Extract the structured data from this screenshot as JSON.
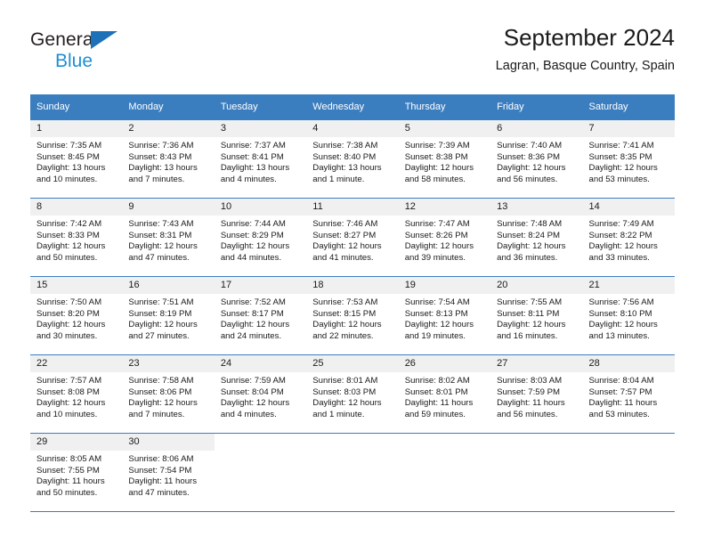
{
  "brand": {
    "name_top": "General",
    "name_bottom": "Blue",
    "accent_color": "#1d8fd4",
    "triangle_color": "#1d71b8"
  },
  "header": {
    "title": "September 2024",
    "location": "Lagran, Basque Country, Spain"
  },
  "theme": {
    "header_bg": "#3b7ec0",
    "daynum_bg": "#f0f0f0",
    "text_color": "#1a1a1a",
    "grid_line": "#3b7ec0"
  },
  "weekdays": [
    "Sunday",
    "Monday",
    "Tuesday",
    "Wednesday",
    "Thursday",
    "Friday",
    "Saturday"
  ],
  "labels": {
    "sunrise_prefix": "Sunrise:",
    "sunset_prefix": "Sunset:",
    "daylight_prefix": "Daylight:"
  },
  "weeks": [
    [
      {
        "day": "1",
        "sunrise": "Sunrise: 7:35 AM",
        "sunset": "Sunset: 8:45 PM",
        "daylight": "Daylight: 13 hours and 10 minutes."
      },
      {
        "day": "2",
        "sunrise": "Sunrise: 7:36 AM",
        "sunset": "Sunset: 8:43 PM",
        "daylight": "Daylight: 13 hours and 7 minutes."
      },
      {
        "day": "3",
        "sunrise": "Sunrise: 7:37 AM",
        "sunset": "Sunset: 8:41 PM",
        "daylight": "Daylight: 13 hours and 4 minutes."
      },
      {
        "day": "4",
        "sunrise": "Sunrise: 7:38 AM",
        "sunset": "Sunset: 8:40 PM",
        "daylight": "Daylight: 13 hours and 1 minute."
      },
      {
        "day": "5",
        "sunrise": "Sunrise: 7:39 AM",
        "sunset": "Sunset: 8:38 PM",
        "daylight": "Daylight: 12 hours and 58 minutes."
      },
      {
        "day": "6",
        "sunrise": "Sunrise: 7:40 AM",
        "sunset": "Sunset: 8:36 PM",
        "daylight": "Daylight: 12 hours and 56 minutes."
      },
      {
        "day": "7",
        "sunrise": "Sunrise: 7:41 AM",
        "sunset": "Sunset: 8:35 PM",
        "daylight": "Daylight: 12 hours and 53 minutes."
      }
    ],
    [
      {
        "day": "8",
        "sunrise": "Sunrise: 7:42 AM",
        "sunset": "Sunset: 8:33 PM",
        "daylight": "Daylight: 12 hours and 50 minutes."
      },
      {
        "day": "9",
        "sunrise": "Sunrise: 7:43 AM",
        "sunset": "Sunset: 8:31 PM",
        "daylight": "Daylight: 12 hours and 47 minutes."
      },
      {
        "day": "10",
        "sunrise": "Sunrise: 7:44 AM",
        "sunset": "Sunset: 8:29 PM",
        "daylight": "Daylight: 12 hours and 44 minutes."
      },
      {
        "day": "11",
        "sunrise": "Sunrise: 7:46 AM",
        "sunset": "Sunset: 8:27 PM",
        "daylight": "Daylight: 12 hours and 41 minutes."
      },
      {
        "day": "12",
        "sunrise": "Sunrise: 7:47 AM",
        "sunset": "Sunset: 8:26 PM",
        "daylight": "Daylight: 12 hours and 39 minutes."
      },
      {
        "day": "13",
        "sunrise": "Sunrise: 7:48 AM",
        "sunset": "Sunset: 8:24 PM",
        "daylight": "Daylight: 12 hours and 36 minutes."
      },
      {
        "day": "14",
        "sunrise": "Sunrise: 7:49 AM",
        "sunset": "Sunset: 8:22 PM",
        "daylight": "Daylight: 12 hours and 33 minutes."
      }
    ],
    [
      {
        "day": "15",
        "sunrise": "Sunrise: 7:50 AM",
        "sunset": "Sunset: 8:20 PM",
        "daylight": "Daylight: 12 hours and 30 minutes."
      },
      {
        "day": "16",
        "sunrise": "Sunrise: 7:51 AM",
        "sunset": "Sunset: 8:19 PM",
        "daylight": "Daylight: 12 hours and 27 minutes."
      },
      {
        "day": "17",
        "sunrise": "Sunrise: 7:52 AM",
        "sunset": "Sunset: 8:17 PM",
        "daylight": "Daylight: 12 hours and 24 minutes."
      },
      {
        "day": "18",
        "sunrise": "Sunrise: 7:53 AM",
        "sunset": "Sunset: 8:15 PM",
        "daylight": "Daylight: 12 hours and 22 minutes."
      },
      {
        "day": "19",
        "sunrise": "Sunrise: 7:54 AM",
        "sunset": "Sunset: 8:13 PM",
        "daylight": "Daylight: 12 hours and 19 minutes."
      },
      {
        "day": "20",
        "sunrise": "Sunrise: 7:55 AM",
        "sunset": "Sunset: 8:11 PM",
        "daylight": "Daylight: 12 hours and 16 minutes."
      },
      {
        "day": "21",
        "sunrise": "Sunrise: 7:56 AM",
        "sunset": "Sunset: 8:10 PM",
        "daylight": "Daylight: 12 hours and 13 minutes."
      }
    ],
    [
      {
        "day": "22",
        "sunrise": "Sunrise: 7:57 AM",
        "sunset": "Sunset: 8:08 PM",
        "daylight": "Daylight: 12 hours and 10 minutes."
      },
      {
        "day": "23",
        "sunrise": "Sunrise: 7:58 AM",
        "sunset": "Sunset: 8:06 PM",
        "daylight": "Daylight: 12 hours and 7 minutes."
      },
      {
        "day": "24",
        "sunrise": "Sunrise: 7:59 AM",
        "sunset": "Sunset: 8:04 PM",
        "daylight": "Daylight: 12 hours and 4 minutes."
      },
      {
        "day": "25",
        "sunrise": "Sunrise: 8:01 AM",
        "sunset": "Sunset: 8:03 PM",
        "daylight": "Daylight: 12 hours and 1 minute."
      },
      {
        "day": "26",
        "sunrise": "Sunrise: 8:02 AM",
        "sunset": "Sunset: 8:01 PM",
        "daylight": "Daylight: 11 hours and 59 minutes."
      },
      {
        "day": "27",
        "sunrise": "Sunrise: 8:03 AM",
        "sunset": "Sunset: 7:59 PM",
        "daylight": "Daylight: 11 hours and 56 minutes."
      },
      {
        "day": "28",
        "sunrise": "Sunrise: 8:04 AM",
        "sunset": "Sunset: 7:57 PM",
        "daylight": "Daylight: 11 hours and 53 minutes."
      }
    ],
    [
      {
        "day": "29",
        "sunrise": "Sunrise: 8:05 AM",
        "sunset": "Sunset: 7:55 PM",
        "daylight": "Daylight: 11 hours and 50 minutes."
      },
      {
        "day": "30",
        "sunrise": "Sunrise: 8:06 AM",
        "sunset": "Sunset: 7:54 PM",
        "daylight": "Daylight: 11 hours and 47 minutes."
      },
      {
        "day": "",
        "sunrise": "",
        "sunset": "",
        "daylight": ""
      },
      {
        "day": "",
        "sunrise": "",
        "sunset": "",
        "daylight": ""
      },
      {
        "day": "",
        "sunrise": "",
        "sunset": "",
        "daylight": ""
      },
      {
        "day": "",
        "sunrise": "",
        "sunset": "",
        "daylight": ""
      },
      {
        "day": "",
        "sunrise": "",
        "sunset": "",
        "daylight": ""
      }
    ]
  ]
}
